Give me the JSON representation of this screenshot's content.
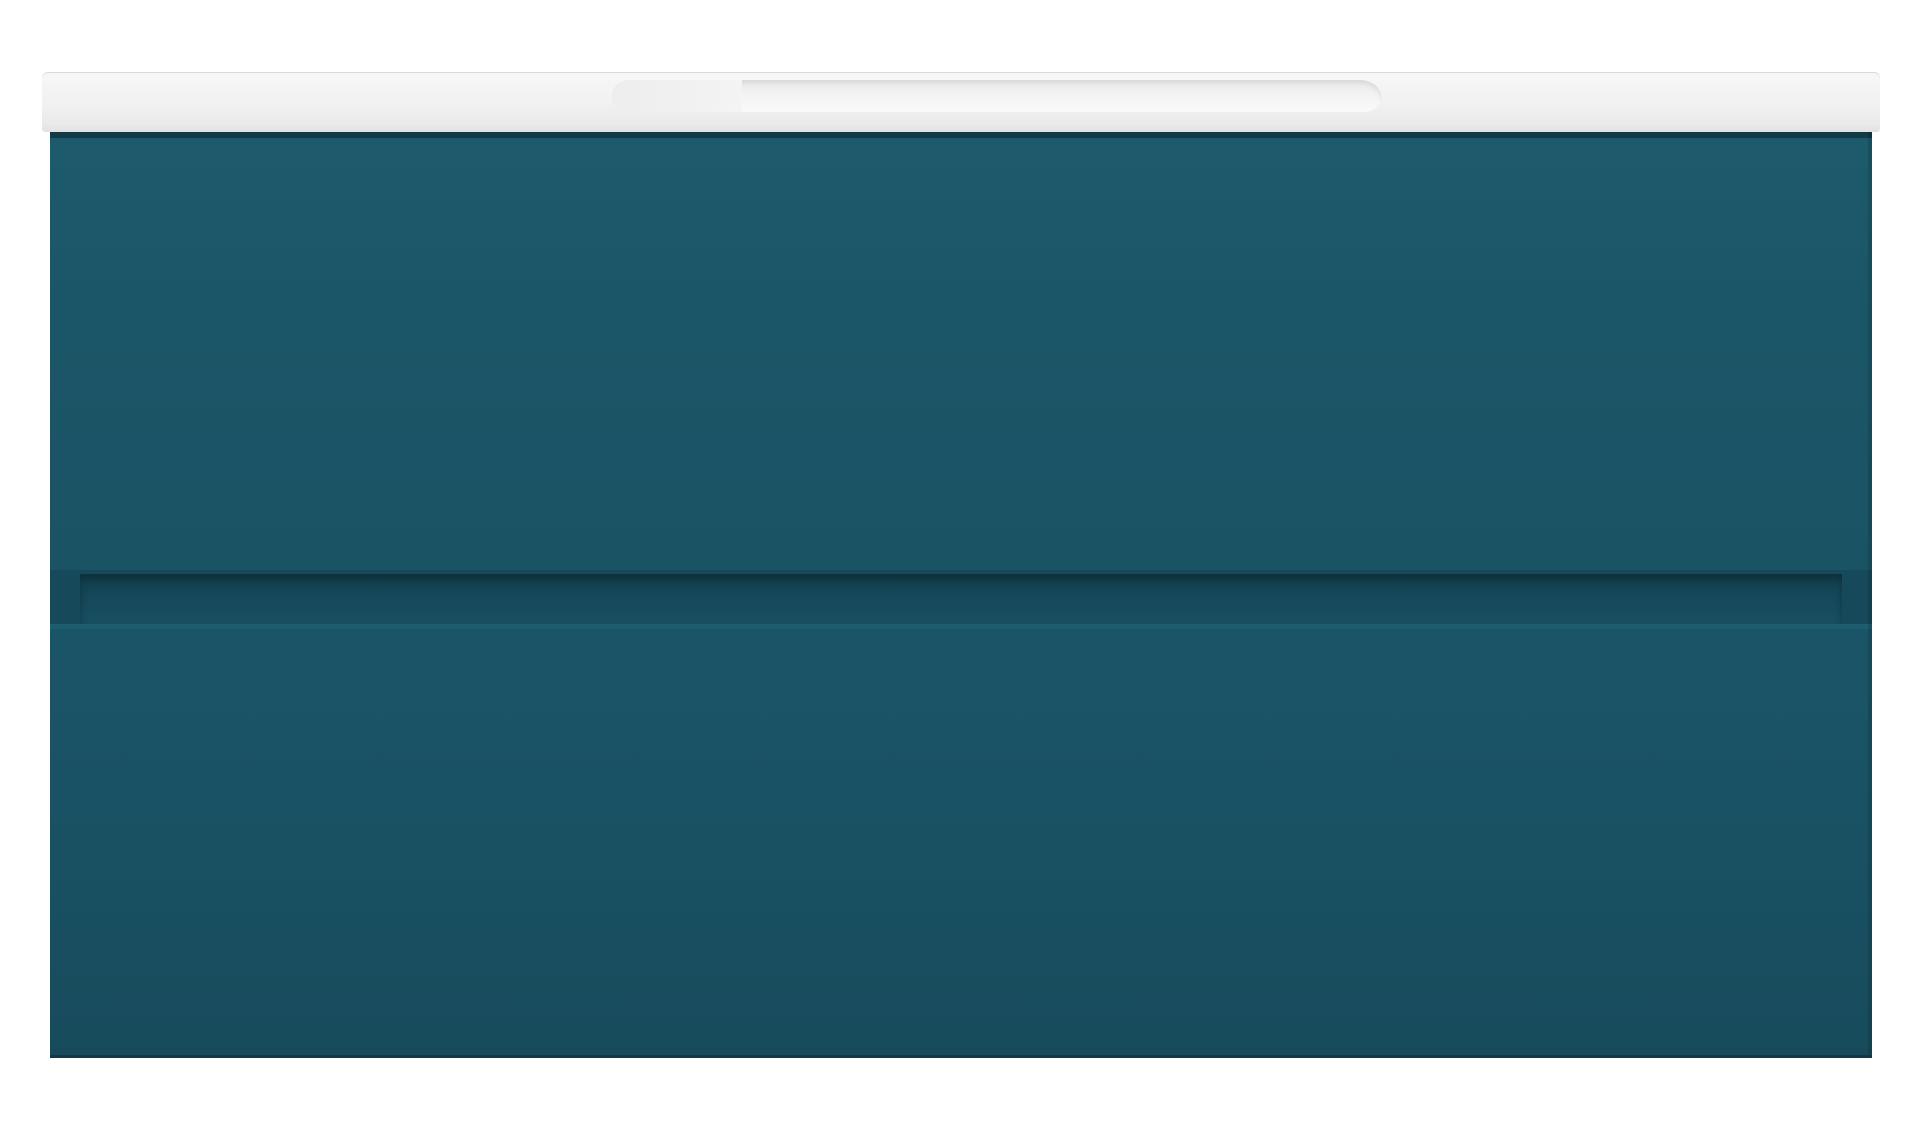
{
  "scene": {
    "subject": "vanity-cabinet",
    "colors": {
      "cabinet": "#1b5566",
      "cabinet_dark": "#16495a",
      "countertop": "#f2f2f2",
      "background": "#ffffff"
    },
    "drawers": [
      {
        "position": "top"
      },
      {
        "position": "bottom"
      }
    ]
  }
}
